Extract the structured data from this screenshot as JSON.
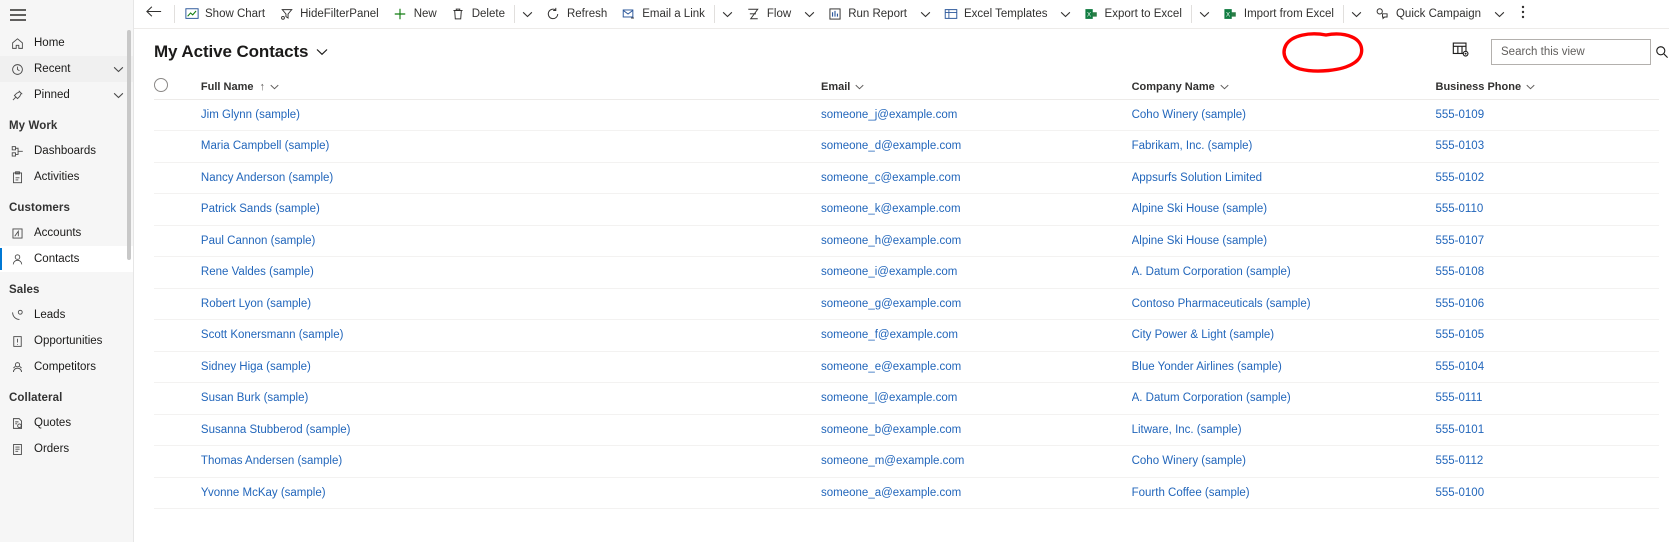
{
  "sidebar": {
    "menu_icon": "hamburger-icon",
    "top_items": [
      {
        "label": "Home",
        "icon": "home-icon",
        "expandable": false,
        "selected": false
      },
      {
        "label": "Recent",
        "icon": "clock-icon",
        "expandable": true,
        "selected": false
      },
      {
        "label": "Pinned",
        "icon": "pin-icon",
        "expandable": true,
        "selected": false
      }
    ],
    "groups": [
      {
        "label": "My Work",
        "items": [
          {
            "label": "Dashboards",
            "icon": "dashboard-icon",
            "selected": false
          },
          {
            "label": "Activities",
            "icon": "activities-icon",
            "selected": false
          }
        ]
      },
      {
        "label": "Customers",
        "items": [
          {
            "label": "Accounts",
            "icon": "accounts-icon",
            "selected": false
          },
          {
            "label": "Contacts",
            "icon": "contact-person-icon",
            "selected": true
          }
        ]
      },
      {
        "label": "Sales",
        "items": [
          {
            "label": "Leads",
            "icon": "leads-icon",
            "selected": false
          },
          {
            "label": "Opportunities",
            "icon": "opportunities-icon",
            "selected": false
          },
          {
            "label": "Competitors",
            "icon": "competitors-icon",
            "selected": false
          }
        ]
      },
      {
        "label": "Collateral",
        "items": [
          {
            "label": "Quotes",
            "icon": "quotes-icon",
            "selected": false
          },
          {
            "label": "Orders",
            "icon": "orders-icon",
            "selected": false
          }
        ]
      }
    ]
  },
  "commandbar": {
    "back_icon": "back-arrow-icon",
    "overflow_icon": "more-vertical-icon",
    "commands": [
      {
        "label": "Show Chart",
        "icon": "show-chart-icon",
        "caret": false
      },
      {
        "label": "HideFilterPanel",
        "icon": "filter-panel-icon",
        "caret": false
      },
      {
        "label": "New",
        "icon": "plus-icon",
        "caret": false
      },
      {
        "label": "Delete",
        "icon": "trash-icon",
        "caret": true,
        "sep_before_caret": true
      },
      {
        "label": "Refresh",
        "icon": "refresh-icon",
        "caret": false
      },
      {
        "label": "Email a Link",
        "icon": "email-link-icon",
        "caret": true,
        "sep_before_caret": true
      },
      {
        "label": "Flow",
        "icon": "flow-icon",
        "caret": true
      },
      {
        "label": "Run Report",
        "icon": "run-report-icon",
        "caret": true
      },
      {
        "label": "Excel Templates",
        "icon": "excel-templates-icon",
        "caret": true
      },
      {
        "label": "Export to Excel",
        "icon": "excel-green-icon",
        "caret": true,
        "sep_before_caret": true
      },
      {
        "label": "Import from Excel",
        "icon": "excel-green-icon",
        "caret": true,
        "sep_before_caret": true
      },
      {
        "label": "Quick Campaign",
        "icon": "quick-campaign-icon",
        "caret": true
      }
    ]
  },
  "view": {
    "title": "My Active Contacts",
    "title_caret_icon": "chevron-down-icon",
    "edit_columns_icon": "edit-columns-icon",
    "search_placeholder": "Search this view",
    "search_value": "",
    "search_icon": "search-icon"
  },
  "annotation": {
    "shape": "hand-drawn-circle",
    "color": "#FF0000",
    "target": "edit-columns-icon"
  },
  "grid": {
    "select_all_icon": "radio-circle-icon",
    "columns": [
      {
        "label": "Full Name",
        "sorted": true,
        "sort_icon": "arrow-up-icon",
        "caret_icon": "chevron-down-icon"
      },
      {
        "label": "Email",
        "sorted": false,
        "caret_icon": "chevron-down-icon"
      },
      {
        "label": "Company Name",
        "sorted": false,
        "caret_icon": "chevron-down-icon"
      },
      {
        "label": "Business Phone",
        "sorted": false,
        "caret_icon": "chevron-down-icon"
      }
    ],
    "rows": [
      {
        "full_name": "Jim Glynn (sample)",
        "email": "someone_j@example.com",
        "company": "Coho Winery (sample)",
        "phone": "555-0109"
      },
      {
        "full_name": "Maria Campbell (sample)",
        "email": "someone_d@example.com",
        "company": "Fabrikam, Inc. (sample)",
        "phone": "555-0103"
      },
      {
        "full_name": "Nancy Anderson (sample)",
        "email": "someone_c@example.com",
        "company": "Appsurfs Solution Limited",
        "phone": "555-0102"
      },
      {
        "full_name": "Patrick Sands (sample)",
        "email": "someone_k@example.com",
        "company": "Alpine Ski House (sample)",
        "phone": "555-0110"
      },
      {
        "full_name": "Paul Cannon (sample)",
        "email": "someone_h@example.com",
        "company": "Alpine Ski House (sample)",
        "phone": "555-0107"
      },
      {
        "full_name": "Rene Valdes (sample)",
        "email": "someone_i@example.com",
        "company": "A. Datum Corporation (sample)",
        "phone": "555-0108"
      },
      {
        "full_name": "Robert Lyon (sample)",
        "email": "someone_g@example.com",
        "company": "Contoso Pharmaceuticals (sample)",
        "phone": "555-0106"
      },
      {
        "full_name": "Scott Konersmann (sample)",
        "email": "someone_f@example.com",
        "company": "City Power & Light (sample)",
        "phone": "555-0105"
      },
      {
        "full_name": "Sidney Higa (sample)",
        "email": "someone_e@example.com",
        "company": "Blue Yonder Airlines (sample)",
        "phone": "555-0104"
      },
      {
        "full_name": "Susan Burk (sample)",
        "email": "someone_l@example.com",
        "company": "A. Datum Corporation (sample)",
        "phone": "555-0111"
      },
      {
        "full_name": "Susanna Stubberod (sample)",
        "email": "someone_b@example.com",
        "company": "Litware, Inc. (sample)",
        "phone": "555-0101"
      },
      {
        "full_name": "Thomas Andersen (sample)",
        "email": "someone_m@example.com",
        "company": "Coho Winery (sample)",
        "phone": "555-0112"
      },
      {
        "full_name": "Yvonne McKay (sample)",
        "email": "someone_a@example.com",
        "company": "Fourth Coffee (sample)",
        "phone": "555-0100"
      }
    ]
  },
  "colors": {
    "accent": "#0078d4",
    "link": "#2266bb",
    "annotation_red": "#FF0000",
    "sidebar_bg": "#f6f6f6"
  }
}
